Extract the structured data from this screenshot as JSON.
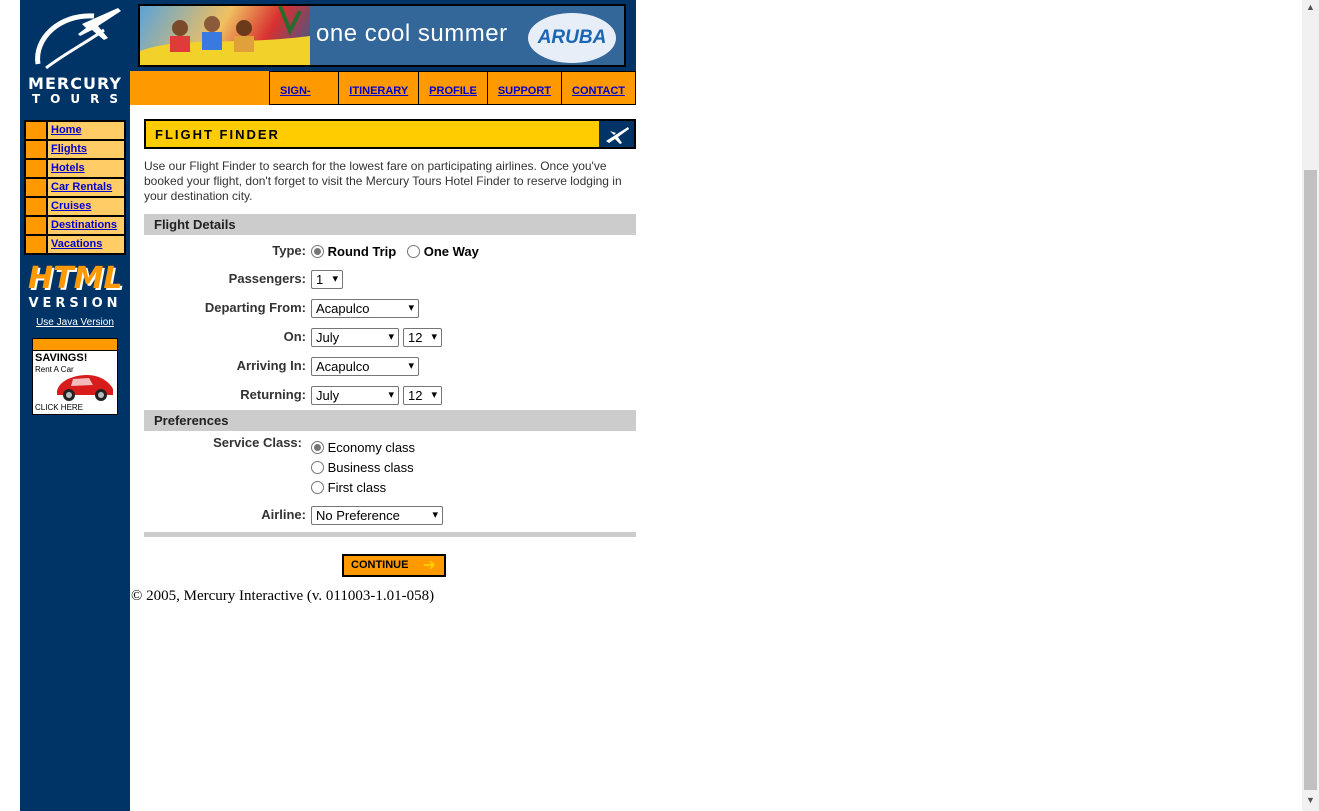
{
  "brand": {
    "line1": "MERCURY",
    "line2": "TOURS"
  },
  "sidebar": {
    "items": [
      {
        "label": "Home"
      },
      {
        "label": "Flights"
      },
      {
        "label": "Hotels"
      },
      {
        "label": "Car Rentals"
      },
      {
        "label": "Cruises"
      },
      {
        "label": "Destinations"
      },
      {
        "label": "Vacations"
      }
    ],
    "html_version": {
      "big": "HTML",
      "sub": "VERSION"
    },
    "java_link": "Use Java Version",
    "savings_ad": {
      "headline": "SAVINGS!",
      "sub": "Rent A Car",
      "cta": "CLICK HERE"
    }
  },
  "banner": {
    "slogan": "one cool summer",
    "badge": "ARUBA"
  },
  "topnav": [
    {
      "label": "SIGN-OFF"
    },
    {
      "label": "ITINERARY"
    },
    {
      "label": "PROFILE"
    },
    {
      "label": "SUPPORT"
    },
    {
      "label": "CONTACT"
    }
  ],
  "page": {
    "title": "FLIGHT FINDER",
    "intro": "Use our Flight Finder to search for the lowest fare on participating airlines. Once you've booked your flight, don't forget to visit the Mercury Tours Hotel Finder to reserve lodging in your destination city."
  },
  "flight_details": {
    "section_title": "Flight Details",
    "type_label": "Type:",
    "type_options": [
      "Round Trip",
      "One Way"
    ],
    "type_selected": "Round Trip",
    "passengers_label": "Passengers:",
    "passengers_value": "1",
    "departing_label": "Departing From:",
    "departing_value": "Acapulco",
    "on_label": "On:",
    "on_month": "July",
    "on_day": "12",
    "arriving_label": "Arriving In:",
    "arriving_value": "Acapulco",
    "returning_label": "Returning:",
    "returning_month": "July",
    "returning_day": "12"
  },
  "preferences": {
    "section_title": "Preferences",
    "service_label": "Service Class:",
    "service_options": [
      "Economy class",
      "Business class",
      "First class"
    ],
    "service_selected": "Economy class",
    "airline_label": "Airline:",
    "airline_value": "No Preference"
  },
  "continue_label": "CONTINUE",
  "footer": "© 2005, Mercury Interactive (v. 011003-1.01-058)",
  "colors": {
    "navy": "#003366",
    "orange": "#ff9900",
    "yellow": "#ffcc00",
    "light_orange": "#ffcc66",
    "gray": "#cccccc",
    "link": "#0000cc"
  }
}
